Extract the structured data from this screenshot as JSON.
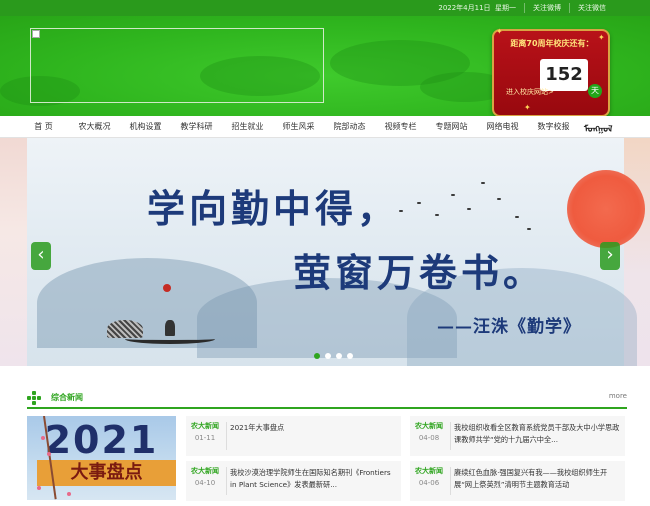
{
  "topbar": {
    "date": "2022年4月11日",
    "weekday": "星期一",
    "weibo": "关注微博",
    "wechat": "关注微信"
  },
  "countdown": {
    "title": "距离70周年校庆还有：",
    "label": "进入校庆网站>",
    "days": "152",
    "unit": "天"
  },
  "nav": {
    "items": [
      "首 页",
      "农大概况",
      "机构设置",
      "教学科研",
      "招生就业",
      "师生风采",
      "院部动态",
      "视频专栏",
      "专题网站",
      "网络电视",
      "数字校报"
    ],
    "mongolian": "ᠮᠣᠩᠭᠣᠯ"
  },
  "banner": {
    "line1": "学向勤中得，",
    "line2": "萤窗万卷书。",
    "line3": "——汪洙《勤学》",
    "prev": "‹",
    "next": "›"
  },
  "news": {
    "section_title": "综合新闻",
    "more": "more",
    "feature_year": "2021",
    "feature_banner": "大事盘点",
    "left": [
      {
        "category": "农大新闻",
        "date": "01-11",
        "title": "2021年大事盘点"
      },
      {
        "category": "农大新闻",
        "date": "04-10",
        "title": "我校沙漠治理学院师生在国际知名期刊《Frontiers in Plant Science》发表最新研..."
      }
    ],
    "right": [
      {
        "category": "农大新闻",
        "date": "04-08",
        "title": "我校组织收看全区教育系统党员干部及大中小学思政课教师共学“党的十九届六中全..."
      },
      {
        "category": "农大新闻",
        "date": "04-06",
        "title": "赓续红色血脉·强国复兴有我——我校组织师生开展“网上祭英烈”清明节主题教育活动"
      }
    ]
  },
  "colors": {
    "brand_green": "#2fa51f",
    "countdown_red": "#b81219"
  }
}
